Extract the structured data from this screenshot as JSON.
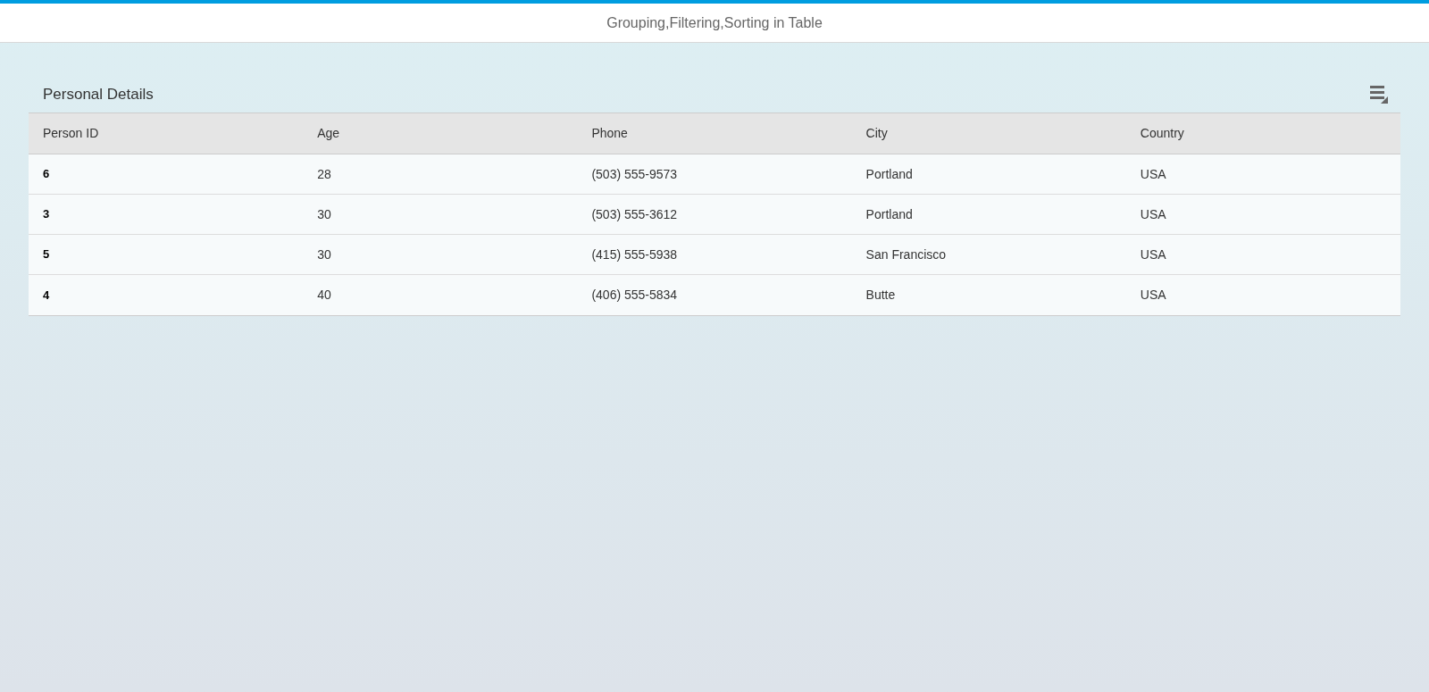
{
  "page": {
    "title": "Grouping,Filtering,Sorting in Table"
  },
  "table": {
    "title": "Personal Details",
    "columns": [
      "Person ID",
      "Age",
      "Phone",
      "City",
      "Country"
    ],
    "rows": [
      [
        "6",
        "28",
        "(503) 555-9573",
        "Portland",
        "USA"
      ],
      [
        "3",
        "30",
        "(503) 555-3612",
        "Portland",
        "USA"
      ],
      [
        "5",
        "30",
        "(415) 555-5938",
        "San Francisco",
        "USA"
      ],
      [
        "4",
        "40",
        "(406) 555-5834",
        "Butte",
        "USA"
      ]
    ]
  }
}
